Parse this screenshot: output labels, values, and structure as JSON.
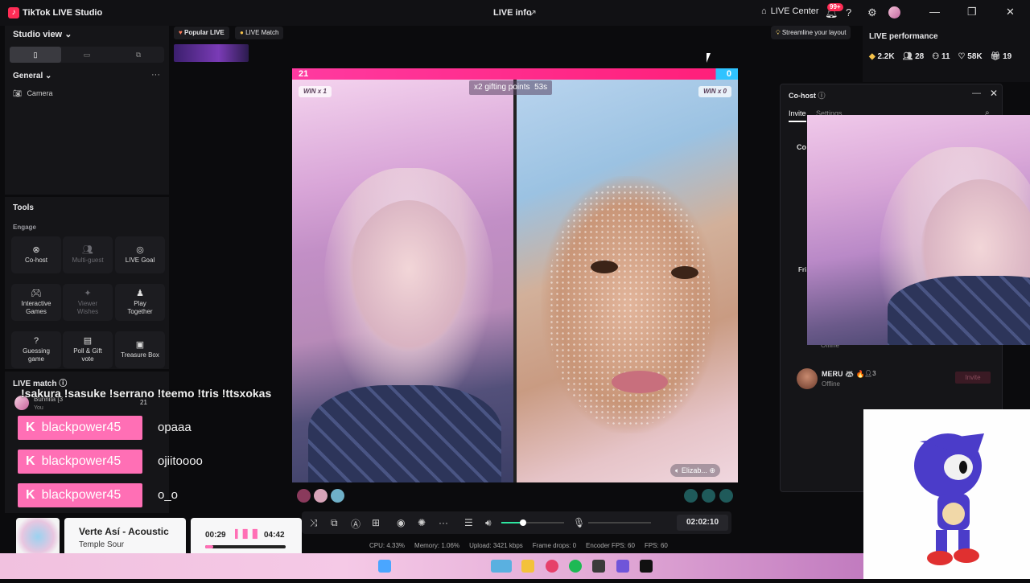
{
  "titlebar": {
    "app_title": "TikTok LIVE Studio",
    "live_info": "LIVE info",
    "live_center": "LIVE Center",
    "notif_badge": "99+"
  },
  "left": {
    "studio_view": "Studio view",
    "general": "General",
    "camera": "Camera",
    "tools_title": "Tools",
    "engage": "Engage",
    "tools": [
      {
        "label1": "Co-host",
        "label2": "",
        "icon": "co-host-icon",
        "disabled": false
      },
      {
        "label1": "Multi-guest",
        "label2": "",
        "icon": "multi-guest-icon",
        "disabled": true
      },
      {
        "label1": "LIVE Goal",
        "label2": "",
        "icon": "live-goal-icon",
        "disabled": false
      },
      {
        "label1": "Interactive",
        "label2": "Games",
        "icon": "games-icon",
        "disabled": false
      },
      {
        "label1": "Viewer",
        "label2": "Wishes",
        "icon": "wishes-icon",
        "disabled": true
      },
      {
        "label1": "Play",
        "label2": "Together",
        "icon": "play-together-icon",
        "disabled": false
      },
      {
        "label1": "Guessing",
        "label2": "game",
        "icon": "guessing-icon",
        "disabled": false
      },
      {
        "label1": "Poll & Gift",
        "label2": "vote",
        "icon": "poll-icon",
        "disabled": false
      },
      {
        "label1": "Treasure Box",
        "label2": "",
        "icon": "treasure-icon",
        "disabled": false
      }
    ],
    "live_match": "LIVE match",
    "match_user": "Bunnita [3",
    "match_you": "You",
    "match_score": "21"
  },
  "tabs": {
    "popular": "Popular LIVE",
    "match": "LIVE Match"
  },
  "stream": {
    "score_left": "21",
    "score_right": "0",
    "win_left": "WIN x 1",
    "win_right": "WIN x 0",
    "gift_pill": "x2 gifting points",
    "gift_timer": "53s",
    "opponent": "Elizab..."
  },
  "overlay": {
    "commands": "!sakura !sasuke !serrano !teemo !tris !ttsxokas"
  },
  "chat": [
    {
      "user": "blackpower45",
      "msg": "opaaa"
    },
    {
      "user": "blackpower45",
      "msg": "ojiitoooo"
    },
    {
      "user": "blackpower45",
      "msg": "o_o"
    }
  ],
  "player": {
    "title": "Verte Así - Acoustic",
    "artist": "Temple Sour",
    "elapsed": "00:29",
    "total": "04:42",
    "progress": 0.1
  },
  "controls": {
    "timer": "02:02:10",
    "volume": 0.35
  },
  "stats": {
    "cpu": "CPU: 4.33%",
    "memory": "Memory: 1.06%",
    "upload": "Upload: 3421 kbps",
    "frame_drops": "Frame drops: 0",
    "encoder_fps": "Encoder FPS: 60",
    "fps": "FPS: 60"
  },
  "right": {
    "tip": "Streamline your layout",
    "perf_title": "LIVE performance",
    "perf": [
      {
        "icon": "diamond-icon",
        "value": "2.2K"
      },
      {
        "icon": "viewers-icon",
        "value": "28"
      },
      {
        "icon": "new-followers-icon",
        "value": "11"
      },
      {
        "icon": "likes-icon",
        "value": "58K"
      },
      {
        "icon": "gift-icon",
        "value": "19"
      }
    ]
  },
  "cohost": {
    "title": "Co-host",
    "tab_invite": "Invite",
    "tab_settings": "Settings",
    "co_label": "Co",
    "fri_label": "Fri",
    "offline1": "Offline",
    "meru_name": "MERU 🦝 🔥",
    "meru_count": "3",
    "meru_status": "Offline",
    "invite": "Invite"
  },
  "colors": {
    "accent": "#fe2c55",
    "chat_pink": "#ff6fb5",
    "vol_green": "#2ee6a0"
  }
}
